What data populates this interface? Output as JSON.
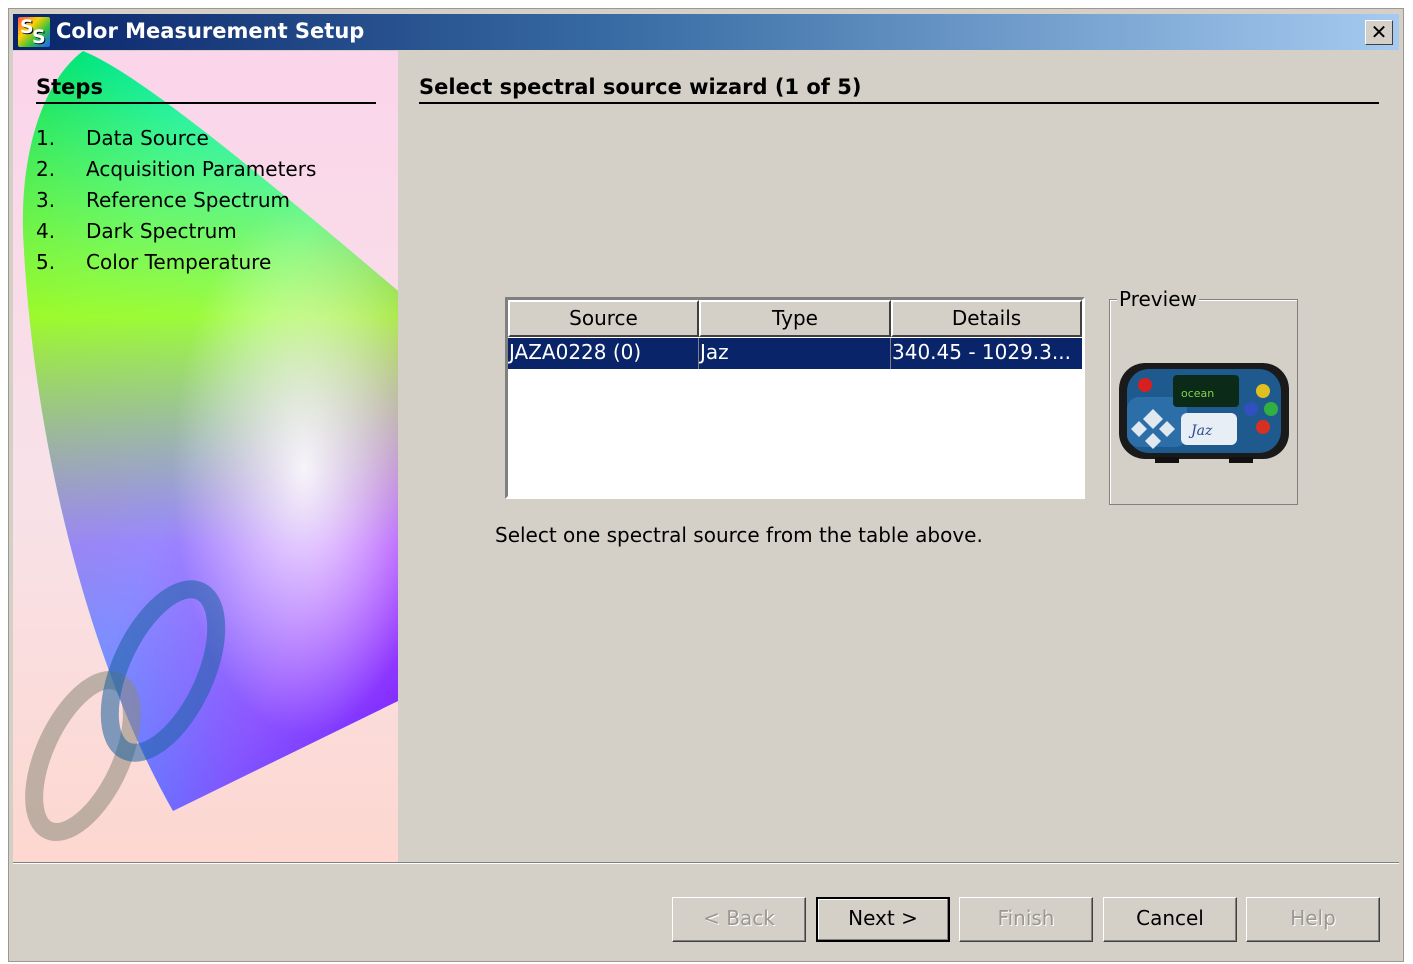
{
  "window": {
    "title": "Color Measurement Setup",
    "icon_name": "spectrasuite-icon",
    "close_label": "✕"
  },
  "sidebar": {
    "heading": "Steps",
    "steps": [
      {
        "num": "1.",
        "label": "Data Source"
      },
      {
        "num": "2.",
        "label": "Acquisition Parameters"
      },
      {
        "num": "3.",
        "label": "Reference Spectrum"
      },
      {
        "num": "4.",
        "label": "Dark Spectrum"
      },
      {
        "num": "5.",
        "label": "Color Temperature"
      }
    ]
  },
  "main": {
    "heading": "Select spectral source wizard (1 of 5)",
    "table": {
      "columns": [
        "Source",
        "Type",
        "Details"
      ],
      "rows": [
        {
          "source": "JAZA0228 (0)",
          "type": "Jaz",
          "details": "340.45 - 1029.3..."
        }
      ],
      "selected_row_color": "#0a246a"
    },
    "preview_label": "Preview",
    "preview_device_brand": "Jaz",
    "hint": "Select one spectral source from the table above."
  },
  "buttons": {
    "back": "< Back",
    "next": "Next >",
    "finish": "Finish",
    "cancel": "Cancel",
    "help": "Help"
  },
  "colors": {
    "titlebar_start": "#0a246a",
    "titlebar_end": "#a6caf0",
    "dialog_bg": "#d4d0c8",
    "sidebar_bg": "#fbd5e8"
  }
}
